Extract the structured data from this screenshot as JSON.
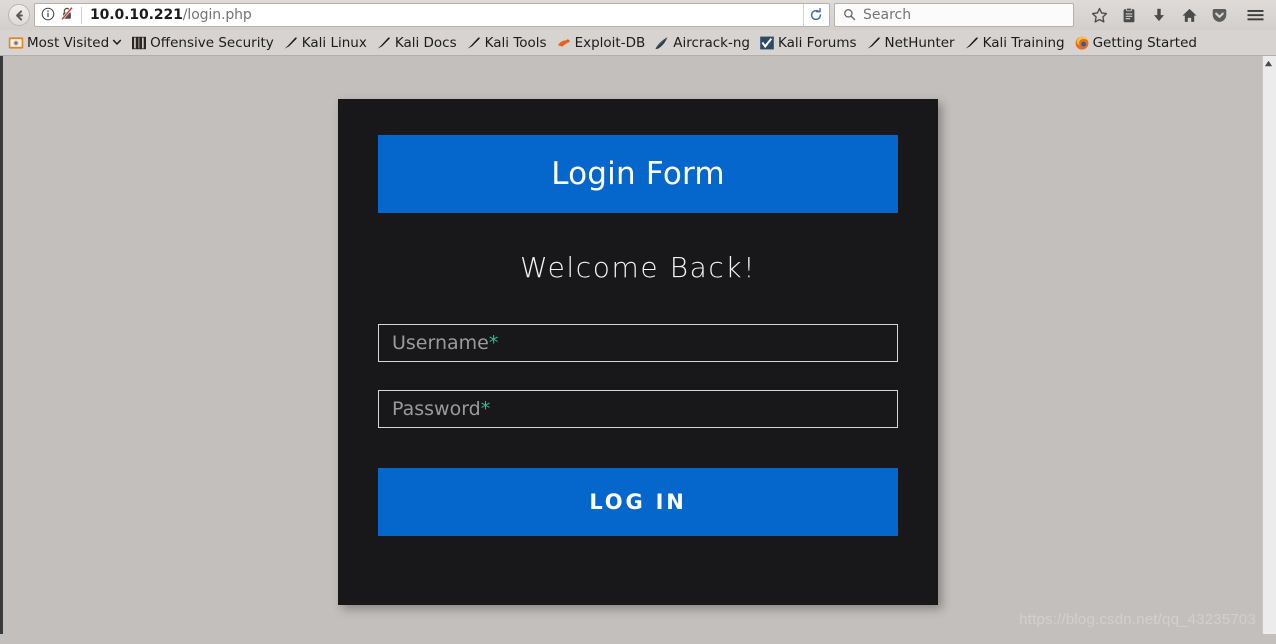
{
  "browser": {
    "back_button": "Back",
    "identity": {
      "info_icon": "info-circle-icon",
      "insecure_icon": "broken-lock-icon"
    },
    "url": {
      "host": "10.0.10.221",
      "path": "/login.php",
      "full": "10.0.10.221/login.php"
    },
    "reload_label": "Reload",
    "search": {
      "placeholder": "Search",
      "value": ""
    },
    "toolbar_icons": [
      {
        "name": "bookmark-star-icon",
        "label": "Bookmark this page"
      },
      {
        "name": "reader-list-icon",
        "label": "Show your bookmarks"
      },
      {
        "name": "download-arrow-icon",
        "label": "Downloads"
      },
      {
        "name": "home-icon",
        "label": "Home"
      },
      {
        "name": "pocket-shield-icon",
        "label": "Save to Pocket"
      },
      {
        "name": "hamburger-menu-icon",
        "label": "Open menu"
      }
    ],
    "bookmarks": [
      {
        "label": "Most Visited",
        "icon": "most-visited-folder-icon",
        "has_chevron": true
      },
      {
        "label": "Offensive Security",
        "icon": "offensive-security-icon",
        "has_chevron": false
      },
      {
        "label": "Kali Linux",
        "icon": "kali-dragon-icon",
        "has_chevron": false
      },
      {
        "label": "Kali Docs",
        "icon": "kali-dragon-icon",
        "has_chevron": false
      },
      {
        "label": "Kali Tools",
        "icon": "kali-dragon-icon",
        "has_chevron": false
      },
      {
        "label": "Exploit-DB",
        "icon": "exploit-db-icon",
        "has_chevron": false
      },
      {
        "label": "Aircrack-ng",
        "icon": "aircrack-ng-icon",
        "has_chevron": false
      },
      {
        "label": "Kali Forums",
        "icon": "kali-forums-icon",
        "has_chevron": false
      },
      {
        "label": "NetHunter",
        "icon": "kali-dragon-icon",
        "has_chevron": false
      },
      {
        "label": "Kali Training",
        "icon": "kali-dragon-icon",
        "has_chevron": false
      },
      {
        "label": "Getting Started",
        "icon": "firefox-icon",
        "has_chevron": false
      }
    ]
  },
  "page": {
    "card": {
      "title": "Login Form",
      "welcome": "Welcome Back!",
      "fields": [
        {
          "name": "username",
          "placeholder_text": "Username",
          "required_marker": "*",
          "value": "",
          "type": "text"
        },
        {
          "name": "password",
          "placeholder_text": "Password",
          "required_marker": "*",
          "value": "",
          "type": "password"
        }
      ],
      "submit_label": "LOG IN"
    },
    "watermark": "https://blog.csdn.net/qq_43235703"
  },
  "colors": {
    "accent_blue": "#0566cb",
    "card_background": "#18181a",
    "page_background": "#c3bfbc",
    "required_green": "#2fbd8f",
    "chrome_background": "#d6d3d0"
  }
}
